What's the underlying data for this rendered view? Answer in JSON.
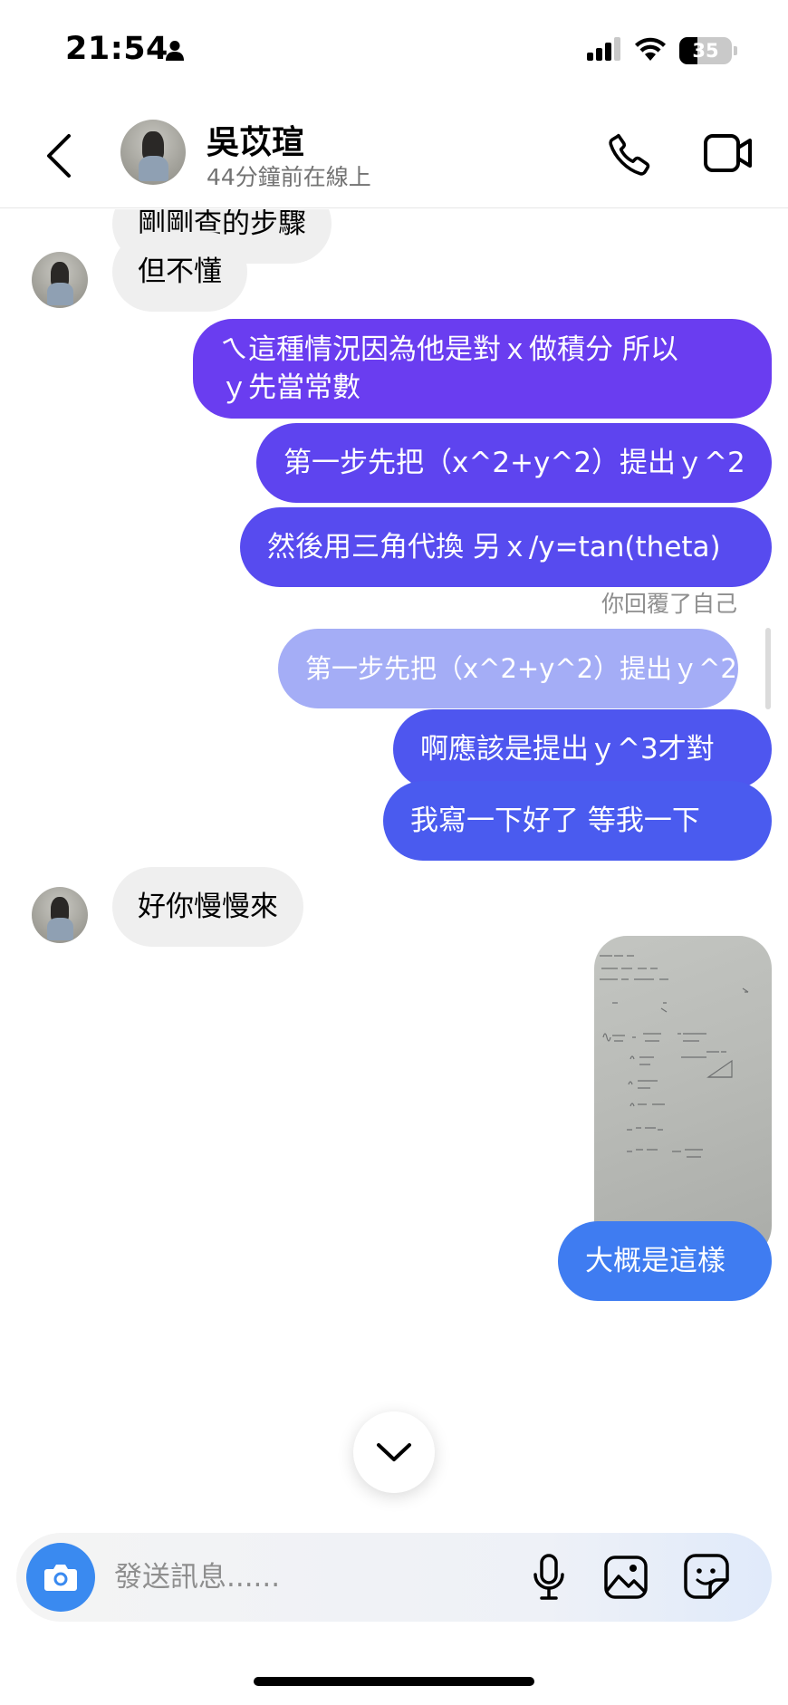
{
  "status_bar": {
    "time": "21:54",
    "battery_level": "35",
    "icons": [
      "person-icon",
      "signal-icon",
      "wifi-icon",
      "battery-icon"
    ]
  },
  "header": {
    "contact_name": "吳苡瑄",
    "contact_status": "44分鐘前在線上",
    "icons": [
      "back-chevron-icon",
      "phone-icon",
      "video-camera-icon"
    ]
  },
  "messages": {
    "in_1": "剛剛查的步驟",
    "in_2": "但不懂",
    "out_1_line1": "ㄟ這種情況因為他是對ｘ做積分 所以",
    "out_1_line2": "ｙ先當常數",
    "out_2": "第一步先把（x^2+y^2）提出ｙ^2",
    "out_3": "然後用三角代換 另ｘ/y=tan(theta)",
    "reply_label": "你回覆了自己",
    "reply_quote": "第一步先把（x^2+y^2）提出ｙ^2",
    "out_4": "啊應該是提出ｙ^3才對",
    "out_5": "我寫一下好了 等我一下",
    "in_3": "好你慢慢來",
    "out_6": "大概是這樣"
  },
  "composer": {
    "placeholder": "發送訊息......",
    "icons": [
      "camera-icon",
      "microphone-icon",
      "gallery-icon",
      "sticker-icon"
    ]
  },
  "colors": {
    "bubble_purple": "#6a3df0",
    "bubble_indigo": "#5c46ee",
    "bubble_blue": "#4a58ef",
    "bubble_sky": "#3f7cf1",
    "reply_quote_bg": "#a4adf6",
    "incoming_bg": "#efefef",
    "camera_blue": "#3a8af0"
  }
}
